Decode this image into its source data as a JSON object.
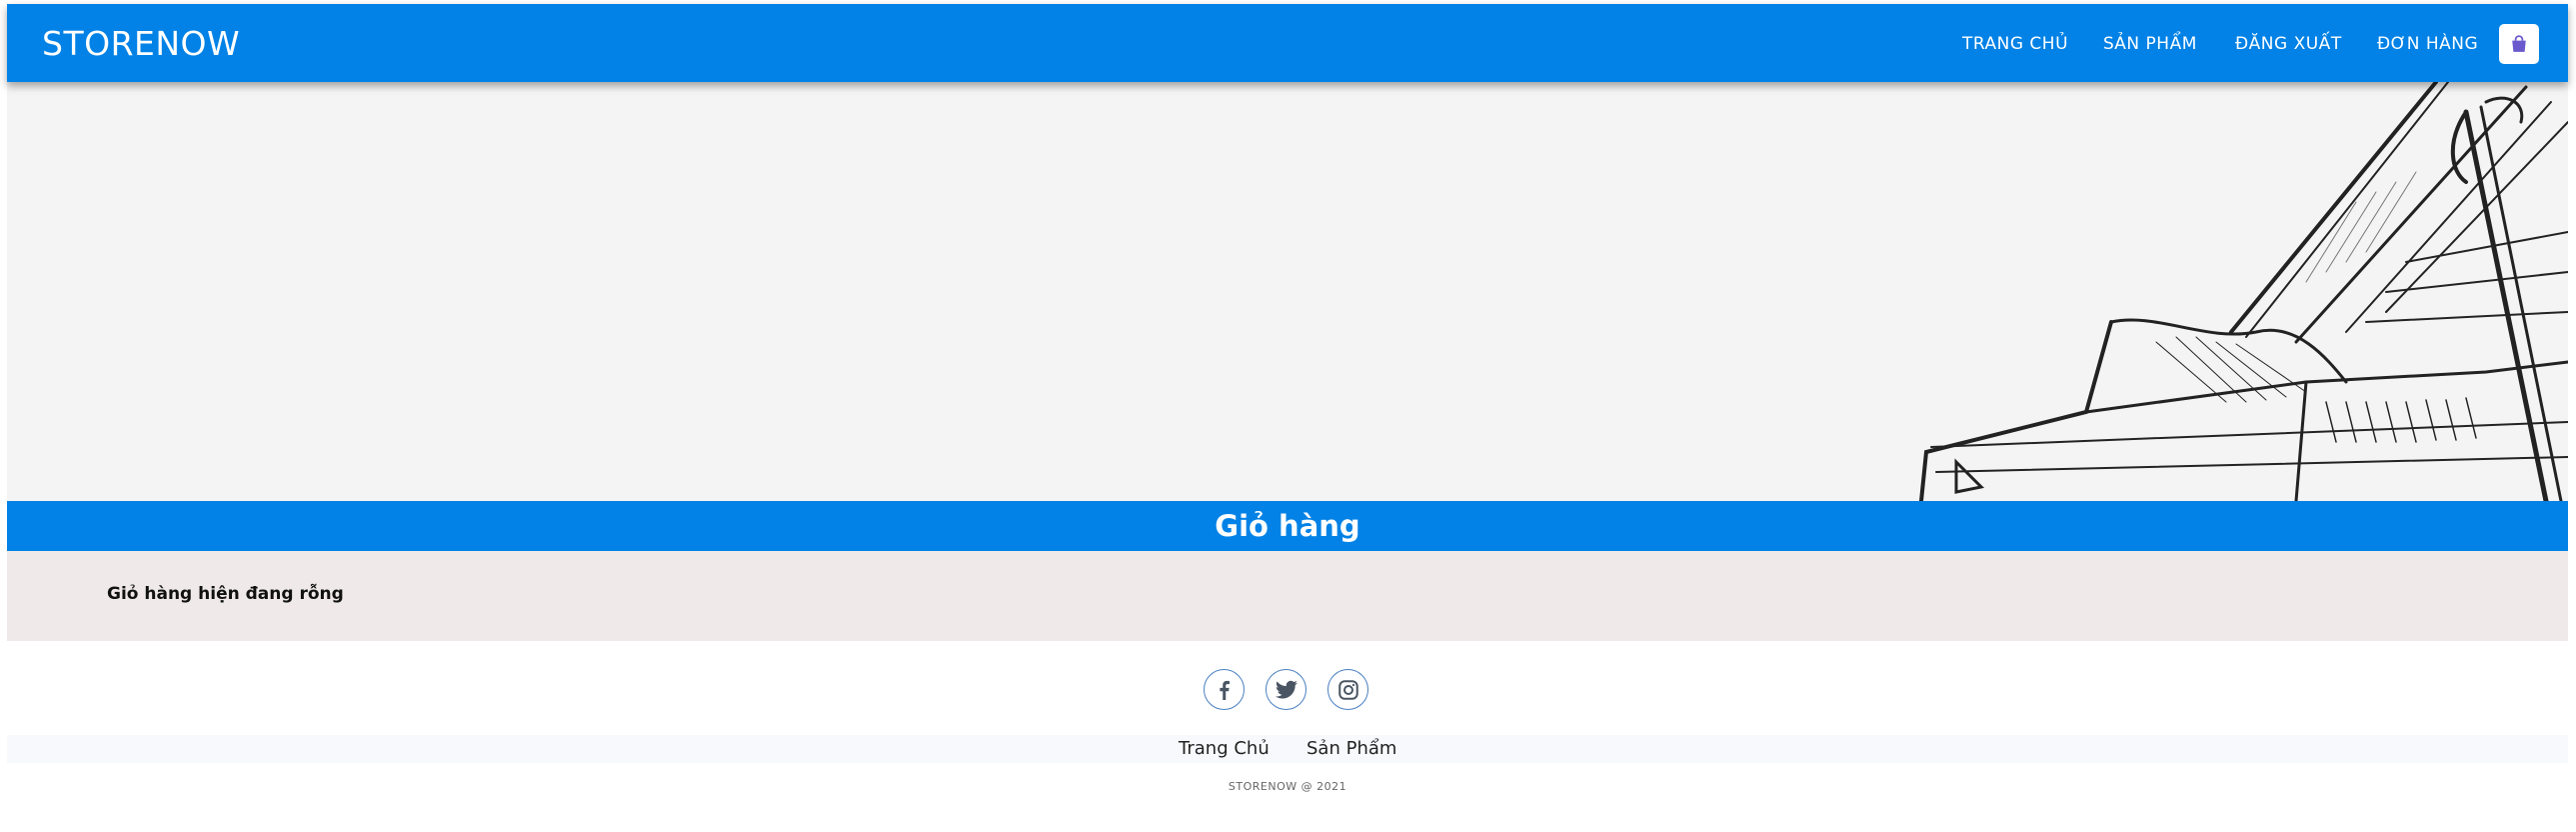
{
  "header": {
    "brand": "STORENOW",
    "nav": [
      "TRANG CHỦ",
      "SẢN PHẨM",
      "ĐĂNG XUẤT",
      "ĐƠN HÀNG"
    ],
    "cart_icon": "shopping-bag-icon"
  },
  "cart": {
    "title": "Giỏ hàng",
    "empty_message": "Giỏ hàng hiện đang rỗng"
  },
  "footer": {
    "social": [
      "facebook-icon",
      "twitter-icon",
      "instagram-icon"
    ],
    "links": [
      "Trang Chủ",
      "Sản Phẩm"
    ],
    "copyright": "STORENOW @ 2021"
  },
  "colors": {
    "primary": "#0282e6",
    "cart_icon": "#6a5acd",
    "social_icon": "#4a5563"
  }
}
